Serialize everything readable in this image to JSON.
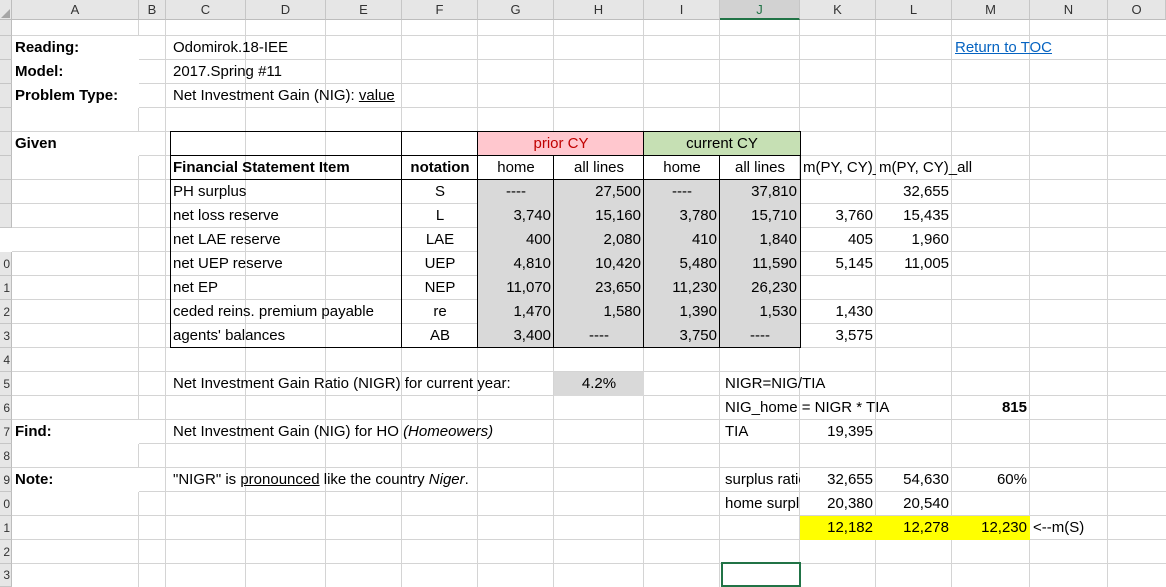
{
  "columns": [
    "A",
    "B",
    "C",
    "D",
    "E",
    "F",
    "G",
    "H",
    "I",
    "J",
    "K",
    "L",
    "M",
    "N",
    "O"
  ],
  "rows": [
    "",
    "",
    "",
    "",
    "",
    "",
    "",
    "",
    "",
    "0",
    "1",
    "2",
    "3",
    "4",
    "5",
    "6",
    "7",
    "8",
    "9",
    "0",
    "1",
    "2",
    "3"
  ],
  "selected_column": "J",
  "header": {
    "reading_label": "Reading:",
    "reading_value": "Odomirok.18-IEE",
    "model_label": "Model:",
    "model_value": "2017.Spring #11",
    "problem_label": "Problem Type:",
    "problem_value_prefix": "Net Investment Gain (NIG): ",
    "problem_value_link": "value",
    "toc_link": "Return to TOC"
  },
  "given_label": "Given",
  "table": {
    "prior_cy": "prior CY",
    "current_cy": "current CY",
    "col_item": "Financial Statement Item",
    "col_notation": "notation",
    "col_home1": "home",
    "col_all1": "all lines",
    "col_home2": "home",
    "col_all2": "all lines",
    "col_mhome": "m(PY, CY)_home",
    "col_mall": "m(PY, CY)_all",
    "rows": [
      {
        "item": "PH surplus",
        "notation": "S",
        "ph": "----",
        "pa": "27,500",
        "ch": "----",
        "ca": "37,810",
        "mh": "",
        "ma": "32,655"
      },
      {
        "item": "net loss reserve",
        "notation": "L",
        "ph": "3,740",
        "pa": "15,160",
        "ch": "3,780",
        "ca": "15,710",
        "mh": "3,760",
        "ma": "15,435"
      },
      {
        "item": "net LAE reserve",
        "notation": "LAE",
        "ph": "400",
        "pa": "2,080",
        "ch": "410",
        "ca": "1,840",
        "mh": "405",
        "ma": "1,960"
      },
      {
        "item": "net UEP reserve",
        "notation": "UEP",
        "ph": "4,810",
        "pa": "10,420",
        "ch": "5,480",
        "ca": "11,590",
        "mh": "5,145",
        "ma": "11,005"
      },
      {
        "item": "net EP",
        "notation": "NEP",
        "ph": "11,070",
        "pa": "23,650",
        "ch": "11,230",
        "ca": "26,230",
        "mh": "",
        "ma": ""
      },
      {
        "item": "ceded reins. premium payable",
        "notation": "re",
        "ph": "1,470",
        "pa": "1,580",
        "ch": "1,390",
        "ca": "1,530",
        "mh": "1,430",
        "ma": ""
      },
      {
        "item": "agents' balances",
        "notation": "AB",
        "ph": "3,400",
        "pa": "----",
        "ch": "3,750",
        "ca": "----",
        "mh": "3,575",
        "ma": ""
      }
    ]
  },
  "nigr": {
    "label": "Net Investment Gain Ratio (NIGR) for current year:",
    "value": "4.2%",
    "formula1": "NIGR=NIG/TIA",
    "formula2": "NIG_home = NIGR * TIA",
    "result": "815",
    "tia_label": "TIA",
    "tia_value": "19,395"
  },
  "find": {
    "label": "Find:",
    "text_prefix": "Net Investment Gain (NIG) for HO ",
    "text_italic": "(Homeowers)"
  },
  "note": {
    "label": "Note:",
    "q1": "\"NIGR\" is ",
    "underlined": "pronounced",
    "q2": " like the country ",
    "italic": "Niger",
    "q3": "."
  },
  "surplus": {
    "ratio_label": "surplus ratio",
    "ratio_a": "32,655",
    "ratio_b": "54,630",
    "ratio_pct": "60%",
    "home_label": "home surplus",
    "home_a": "20,380",
    "home_b": "20,540",
    "y1": "12,182",
    "y2": "12,278",
    "y3": "12,230",
    "note": "<--m(S)"
  }
}
